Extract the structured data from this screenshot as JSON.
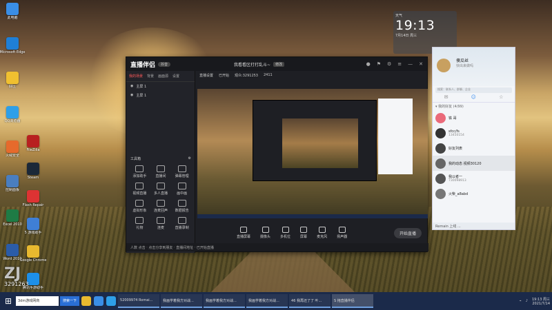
{
  "desktop_icons_col1": [
    {
      "label": "此电脑",
      "color": "#3a8ee6"
    },
    {
      "label": "Microsoft Edge",
      "color": "#1f7fd6"
    },
    {
      "label": "好压",
      "color": "#f0c030"
    },
    {
      "label": "QQ浏览器",
      "color": "#2e9fe8"
    },
    {
      "label": "火绒安全",
      "color": "#e66a2c"
    },
    {
      "label": "控制面板",
      "color": "#4a7ec0"
    },
    {
      "label": "Excel 2010",
      "color": "#1e7b45"
    },
    {
      "label": "Word 2010",
      "color": "#2b5ca8"
    }
  ],
  "desktop_icons_col2": [
    {
      "label": "FileZilla",
      "color": "#b82020"
    },
    {
      "label": "Steam",
      "color": "#1b2838"
    },
    {
      "label": "Flash Repair",
      "color": "#d33"
    },
    {
      "label": "5 游戏助手",
      "color": "#3f7fd6"
    },
    {
      "label": "Google Chrome",
      "color": "#e8b92f"
    },
    {
      "label": "腾讯手游助手",
      "color": "#1d8fe8"
    }
  ],
  "weather": {
    "time": "19:13",
    "date": "7月14日",
    "day": "周三",
    "label": "天气"
  },
  "app": {
    "logo": "直播伴侣",
    "version": "抖音",
    "project": "我看看区打打乱斗~",
    "project_badge": "修改",
    "left_tabs": [
      "我的场景",
      "背景",
      "画面源",
      "设置"
    ],
    "scenes": [
      "主屏 1",
      "主屏 1"
    ],
    "tools_header": "工具箱",
    "tools": [
      "添加助手",
      "直播间",
      "弹幕管理",
      "视频直播",
      "多人直播",
      "画中画",
      "虚拟形象",
      "连麦回声",
      "数据报告",
      "礼物",
      "连麦",
      "直播录制"
    ],
    "prevbar": [
      "直播设置",
      "已开始",
      "观众:3291253",
      "2411"
    ],
    "footer": "人数 点击 ‧ 点击分享到朋友 ‧ 直播间地址 ‧ 已开始直播",
    "controls": [
      "直播屏幕",
      "摄像头",
      "多机位",
      "屏幕",
      "麦克风",
      "扬声器"
    ],
    "go_live": "开始直播"
  },
  "chat": {
    "name": "傻瓜丝",
    "signature": "快出来做吗",
    "search_placeholder": "搜索：联系人、群聊、企业",
    "group": "▾ 我的好友 (4/99)",
    "rows": [
      {
        "name": "铁 哥",
        "sub": "",
        "color": "#ea6a7a"
      },
      {
        "name": "sfcc/fs",
        "sub": "13450154",
        "color": "#333"
      },
      {
        "name": "好友列表",
        "sub": "",
        "color": "#444"
      },
      {
        "name": "我的动态 视频30120",
        "sub": "",
        "color": "#666"
      },
      {
        "name": "我以者一",
        "sub": "730098913",
        "color": "#555"
      },
      {
        "name": "火柴_a8abd",
        "sub": "",
        "color": "#777"
      }
    ],
    "bottom": "Remain 上线 ..."
  },
  "badge_number": "3291263",
  "badge_big": "ZJ",
  "taskbar": {
    "search": "3dm游戏网商",
    "search_btn": "搜索一下",
    "items": [
      "52009974 Romai...",
      "我画学着我方对战...",
      "我画学着我方对战...",
      "我画学着我方对战...",
      "46 我再还了了 叶...",
      "S 拖直播伴侣"
    ],
    "tray_time": "19:13 周三",
    "tray_date": "2021/7/14"
  }
}
